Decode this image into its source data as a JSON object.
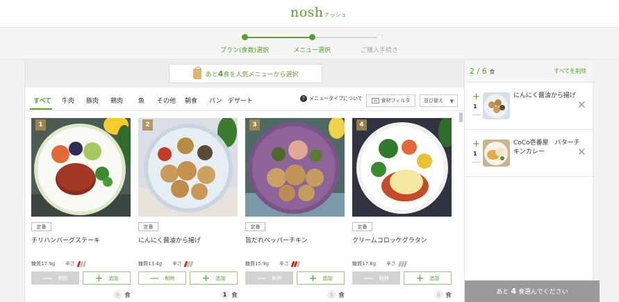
{
  "logo": {
    "main": "nosh",
    "kana": "ナッシュ"
  },
  "steps": [
    {
      "label": "プラン(食数)選択",
      "state": "done"
    },
    {
      "label": "メニュー選択",
      "state": "current"
    },
    {
      "label": "ご購入手続き",
      "state": "todo"
    }
  ],
  "banner": {
    "prefix": "あと",
    "count": "4",
    "suffix": "食を人気メニューから選択"
  },
  "categories": [
    "すべて",
    "牛肉",
    "豚肉",
    "鶏肉",
    "魚",
    "その他",
    "朝食",
    "パン",
    "デザート"
  ],
  "toolbar": {
    "menu_type": "メニュータイプについて",
    "filter": "食材フィルタ",
    "sort": "並び替え"
  },
  "menu": [
    {
      "rank": "1",
      "badge": "定番",
      "name": "チリハンバーグステーキ",
      "carbs": "糖質17.9g",
      "spicy_label": "辛さ",
      "spice": 1,
      "delete_label": "削除",
      "add_label": "追加",
      "count": "0",
      "unit": "食"
    },
    {
      "rank": "2",
      "badge": "定番",
      "name": "にんにく醤油から揚げ",
      "carbs": "糖質13.4g",
      "spicy_label": "辛さ",
      "spice": 1,
      "delete_label": "削除",
      "add_label": "追加",
      "count": "1",
      "unit": "食"
    },
    {
      "rank": "3",
      "badge": "定番",
      "name": "旨だれペッパーチキン",
      "carbs": "糖質15.9g",
      "spicy_label": "辛さ",
      "spice": 2,
      "delete_label": "削除",
      "add_label": "追加",
      "count": "0",
      "unit": "食"
    },
    {
      "rank": "4",
      "badge": "定番",
      "name": "クリームコロッケグラタン",
      "carbs": "糖質17.8g",
      "spicy_label": "辛さ",
      "spice": 0,
      "delete_label": "削除",
      "add_label": "追加",
      "count": "0",
      "unit": "食"
    }
  ],
  "cart": {
    "selected": "2",
    "total": "6",
    "unit": "食",
    "clear_label": "すべてを削除",
    "items": [
      {
        "qty": "1",
        "name": "にんにく醤油から揚げ"
      },
      {
        "qty": "1",
        "name": "CoCo壱番屋　バターチキンカレー"
      }
    ],
    "footer_prefix": "あと",
    "footer_count": "4",
    "footer_suffix": "食選んでください"
  },
  "colors": {
    "brand": "#5a9e2e",
    "pepper_on": "#d22b1d",
    "pepper_off": "#bdbdbd"
  }
}
